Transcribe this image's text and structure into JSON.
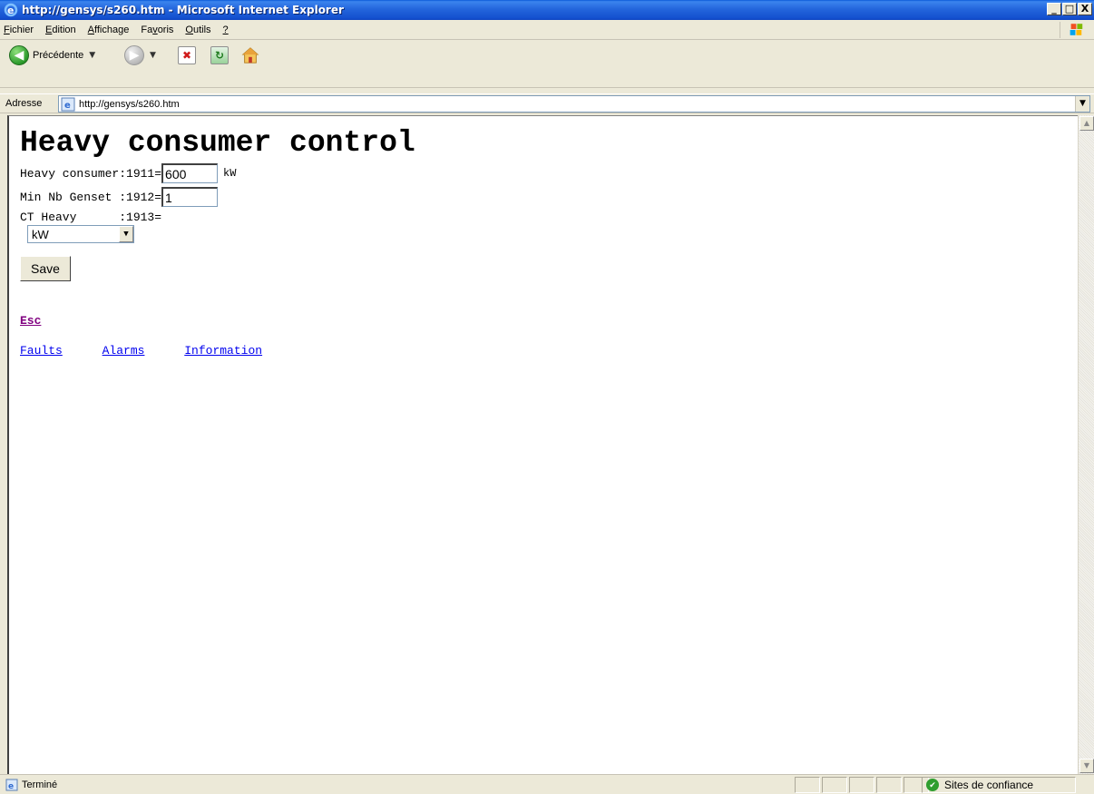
{
  "window": {
    "title": "http://gensys/s260.htm - Microsoft Internet Explorer",
    "min_label": "_",
    "max_label": "□",
    "close_label": "X"
  },
  "menu": {
    "items": [
      {
        "acc": "F",
        "rest": "ichier"
      },
      {
        "acc": "E",
        "rest": "dition"
      },
      {
        "acc": "A",
        "rest": "ffichage"
      },
      {
        "pre": "Fa",
        "acc": "v",
        "rest": "oris"
      },
      {
        "acc": "O",
        "rest": "utils"
      },
      {
        "acc": "?",
        "rest": ""
      }
    ]
  },
  "toolbar": {
    "back_label": "Précédente"
  },
  "address": {
    "label": "Adresse",
    "url": "http://gensys/s260.htm"
  },
  "page": {
    "heading": "Heavy consumer control",
    "fields": [
      {
        "label": "Heavy consumer:1911=",
        "value": "600",
        "unit": "kW"
      },
      {
        "label": "Min Nb Genset :1912=",
        "value": "1",
        "unit": ""
      },
      {
        "label": "CT Heavy      :1913=",
        "value": "",
        "unit": ""
      }
    ],
    "select_value": "kW",
    "save_label": "Save",
    "esc_label": "Esc",
    "links": [
      "Faults",
      "Alarms",
      "Information"
    ]
  },
  "status": {
    "text": "Terminé",
    "zone": "Sites de confiance"
  },
  "colors": {
    "titlebar": "#2466dc",
    "visited_link": "#800080",
    "link": "#0000ee"
  }
}
